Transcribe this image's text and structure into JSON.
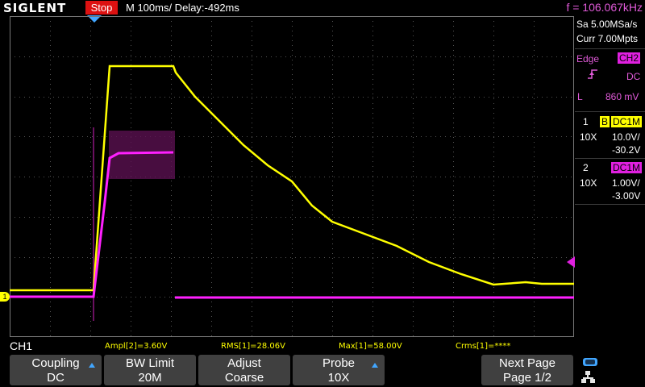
{
  "top": {
    "brand": "SIGLENT",
    "status": "Stop",
    "timebase": "M 100ms/  Delay:-492ms",
    "frequency": "f = 106.067kHz"
  },
  "right": {
    "sample_rate": "Sa 5.00MSa/s",
    "memory": "Curr 7.00Mpts",
    "trigger_type": "Edge",
    "trigger_source": "CH2",
    "trigger_coupling": "DC",
    "trigger_level_label": "L",
    "trigger_level": "860 mV",
    "ch1": {
      "num": "1",
      "bw": "B",
      "coupling": "DC1M",
      "probe": "10X",
      "scale": "10.0V/",
      "offset": "-30.2V"
    },
    "ch2": {
      "num": "2",
      "coupling": "DC1M",
      "probe": "10X",
      "scale": "1.00V/",
      "offset": "-3.00V"
    }
  },
  "measure": {
    "channel": "CH1",
    "ampl": "Ampl[2]=3.60V",
    "rms": "RMS[1]=28.06V",
    "max": "Max[1]=58.00V",
    "crms": "Crms[1]=****"
  },
  "softkeys": [
    {
      "title": "Coupling",
      "value": "DC"
    },
    {
      "title": "BW Limit",
      "value": "20M"
    },
    {
      "title": "Adjust",
      "value": "Coarse"
    },
    {
      "title": "Probe",
      "value": "10X"
    },
    {
      "title": "Next Page",
      "value": "Page 1/2"
    }
  ],
  "markers": {
    "ch1_marker": "1"
  },
  "colors": {
    "ch1": "#ffff00",
    "ch2": "#e020e0",
    "accent": "#41a6ff",
    "stop": "#dd1111"
  }
}
